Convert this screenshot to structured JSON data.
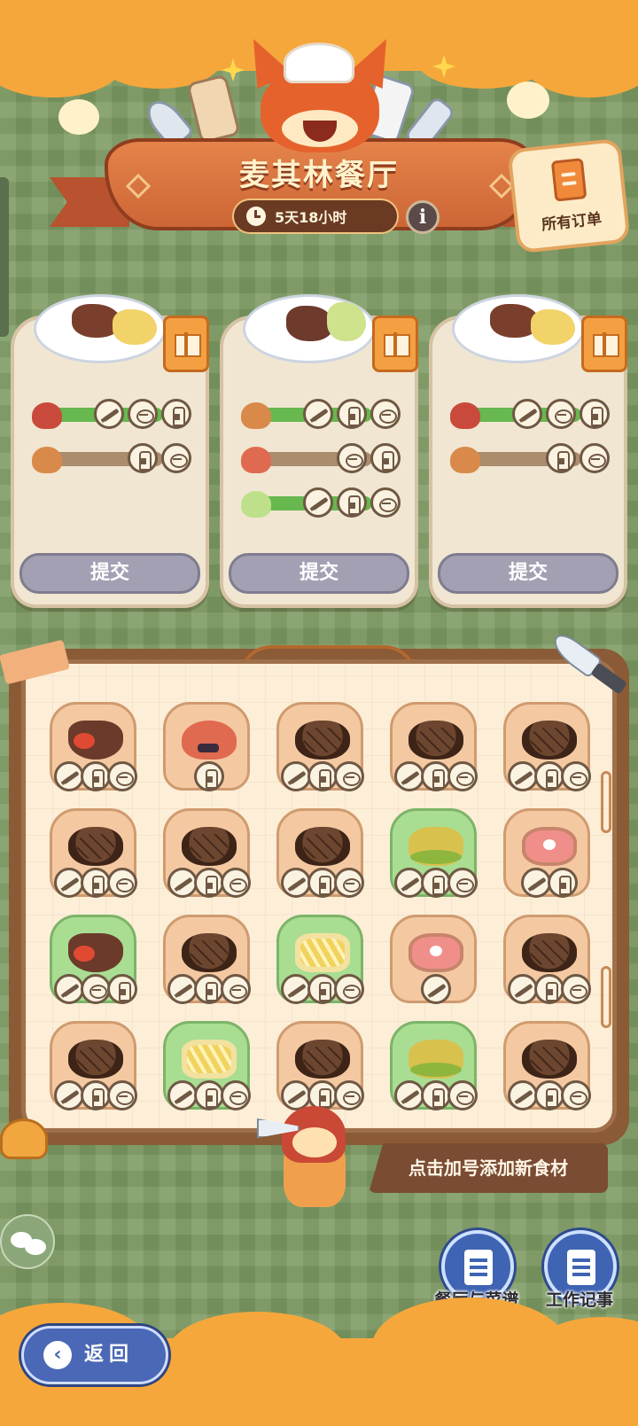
{
  "header": {
    "title": "麦其林餐厅",
    "timer": "5天18小时",
    "info_icon": "i",
    "all_orders_label": "所有订单"
  },
  "orders": [
    {
      "submit_label": "提交",
      "rows": [
        {
          "ingredient": "crab-meat",
          "steps": [
            "knife",
            "grill",
            "shaker"
          ],
          "done": true
        },
        {
          "ingredient": "mushroom",
          "steps": [
            "shaker",
            "grill"
          ],
          "done": false
        }
      ]
    },
    {
      "submit_label": "提交",
      "rows": [
        {
          "ingredient": "mushroom",
          "steps": [
            "knife",
            "shaker",
            "grill"
          ],
          "done": true
        },
        {
          "ingredient": "crab",
          "steps": [
            "grill",
            "shaker"
          ],
          "done": false
        },
        {
          "ingredient": "cucumber",
          "steps": [
            "knife",
            "shaker",
            "grill"
          ],
          "done": true
        }
      ]
    },
    {
      "submit_label": "提交",
      "rows": [
        {
          "ingredient": "crab-meat",
          "steps": [
            "knife",
            "grill",
            "shaker"
          ],
          "done": true
        },
        {
          "ingredient": "mushroom",
          "steps": [
            "shaker",
            "grill"
          ],
          "done": false
        }
      ]
    }
  ],
  "ingredients": [
    [
      {
        "food": "crab-raw",
        "fresh": false,
        "steps": [
          "knife",
          "shaker",
          "grill"
        ]
      },
      {
        "food": "crab",
        "fresh": false,
        "steps": [
          "shaker"
        ]
      },
      {
        "food": "steak",
        "fresh": false,
        "steps": [
          "knife",
          "shaker",
          "grill"
        ]
      },
      {
        "food": "steak",
        "fresh": false,
        "steps": [
          "knife",
          "shaker",
          "grill"
        ]
      },
      {
        "food": "steak",
        "fresh": false,
        "steps": [
          "knife",
          "shaker",
          "grill"
        ]
      }
    ],
    [
      {
        "food": "steak",
        "fresh": false,
        "steps": [
          "knife",
          "shaker",
          "grill"
        ]
      },
      {
        "food": "steak",
        "fresh": false,
        "steps": [
          "knife",
          "shaker",
          "grill"
        ]
      },
      {
        "food": "steak",
        "fresh": false,
        "steps": [
          "knife",
          "shaker",
          "grill"
        ]
      },
      {
        "food": "leaf",
        "fresh": true,
        "steps": [
          "knife",
          "shaker",
          "grill"
        ]
      },
      {
        "food": "ham",
        "fresh": false,
        "steps": [
          "knife",
          "shaker"
        ]
      }
    ],
    [
      {
        "food": "crab-raw",
        "fresh": true,
        "steps": [
          "knife",
          "grill",
          "shaker"
        ]
      },
      {
        "food": "steak",
        "fresh": false,
        "steps": [
          "knife",
          "shaker",
          "grill"
        ]
      },
      {
        "food": "fries",
        "fresh": true,
        "steps": [
          "knife",
          "shaker",
          "grill"
        ]
      },
      {
        "food": "ham",
        "fresh": false,
        "steps": [
          "knife"
        ]
      },
      {
        "food": "steak",
        "fresh": false,
        "steps": [
          "knife",
          "shaker",
          "grill"
        ]
      }
    ],
    [
      {
        "food": "steak",
        "fresh": false,
        "steps": [
          "knife",
          "shaker",
          "grill"
        ]
      },
      {
        "food": "fries",
        "fresh": true,
        "steps": [
          "knife",
          "shaker",
          "grill"
        ]
      },
      {
        "food": "steak",
        "fresh": false,
        "steps": [
          "knife",
          "shaker",
          "grill"
        ]
      },
      {
        "food": "leaf",
        "fresh": true,
        "steps": [
          "knife",
          "shaker",
          "grill"
        ]
      },
      {
        "food": "steak",
        "fresh": false,
        "steps": [
          "knife",
          "shaker",
          "grill"
        ]
      }
    ]
  ],
  "hint": "点击加号添加新食材",
  "buttons": {
    "recipes_label": "餐厅与菜谱",
    "journal_label": "工作记事",
    "back_label": "返回",
    "back_icon": "‹"
  },
  "colors": {
    "background": "#7c9a62",
    "accent": "#f6a73b",
    "banner": "#cd6636",
    "submit_disabled": "#a3a0b3",
    "progress_done": "#66b84f",
    "progress_pending": "#ab8c6c",
    "button_blue": "#3f64b3"
  }
}
